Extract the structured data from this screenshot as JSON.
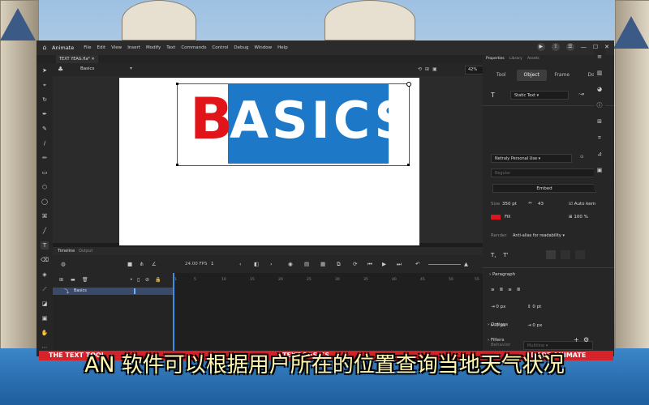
{
  "menubar": {
    "brand": "Animate",
    "items": [
      "File",
      "Edit",
      "View",
      "Insert",
      "Modify",
      "Text",
      "Commands",
      "Control",
      "Debug",
      "Window",
      "Help"
    ]
  },
  "document": {
    "tab": "TEXT YEAG.fla*"
  },
  "scene": {
    "name": "Basics",
    "zoom": "42%"
  },
  "stage": {
    "logo_b": "B",
    "logo_rest": "ASICS"
  },
  "timeline": {
    "tabs": [
      "Timeline",
      "Output"
    ],
    "fps": "24.00",
    "fps_unit": "FPS",
    "frame": "1",
    "layer_name": "Basics",
    "ruler": [
      "1",
      "5",
      "10",
      "15",
      "20",
      "25",
      "30",
      "35",
      "40",
      "45",
      "50",
      "55"
    ]
  },
  "properties": {
    "tabs": [
      "Properties",
      "Library",
      "Assets"
    ],
    "segments": [
      "Tool",
      "Object",
      "Frame",
      "Doc"
    ],
    "text_type": "Static Text",
    "font": "Netraly Personal Use",
    "style": "Regular",
    "embed": "Embed",
    "size_label": "Size",
    "size": "350 pt",
    "tracking": "43",
    "auto_kern": "Auto kern",
    "fill_label": "Fill",
    "fill_pct": "100 %",
    "render_label": "Render",
    "render": "Anti-alias for readability",
    "paragraph": "Paragraph",
    "px_values": [
      "0 px",
      "0 pt",
      "0 px",
      "0 px"
    ],
    "behavior_label": "Behavior",
    "behavior": "Multiline",
    "options": "Options",
    "filters": "Filters"
  },
  "overlay": {
    "banner_left": "THE TEXT TOOL",
    "banner_mid": "TEXT BASICS",
    "banner_right": "ADOBE ANIMATE",
    "subtitle": "AN 软件可以根据用户所在的位置查询当地天气状况"
  },
  "colors": {
    "accent_red": "#e1141a",
    "logo_blue": "#1e78c8",
    "playhead": "#3d8ee8"
  }
}
